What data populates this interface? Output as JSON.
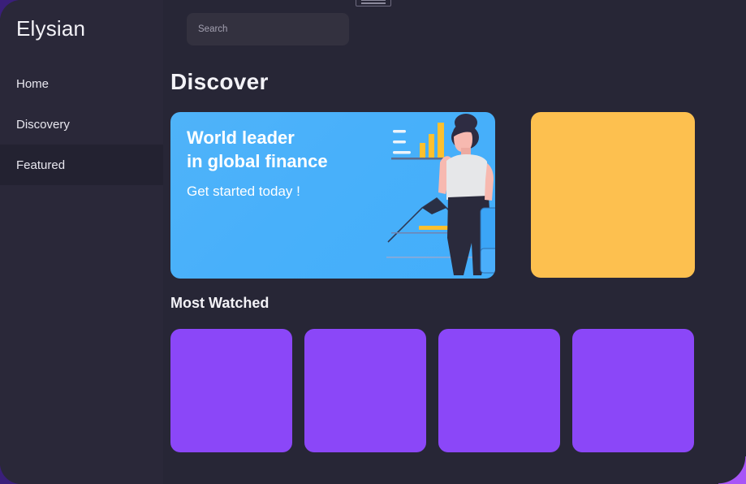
{
  "app": {
    "brand": "Elysian",
    "accent_purple": "#8b47f8",
    "accent_yellow": "#fdc04f",
    "accent_blue": "#48b0fa",
    "background": "#272636",
    "sidebar_background": "#2a2839"
  },
  "window_handle": {
    "icon": "window-drag-handle-icon"
  },
  "search": {
    "placeholder": "Search",
    "value": ""
  },
  "sidebar": {
    "items": [
      {
        "label": "Home",
        "active": false
      },
      {
        "label": "Discovery",
        "active": false
      },
      {
        "label": "Featured",
        "active": true
      }
    ]
  },
  "main": {
    "page_title": "Discover",
    "hero": {
      "title": "World leader\nin global finance",
      "subtitle": "Get started today !",
      "illustration": "business-woman-with-bar-chart-illustration",
      "background_color": "#48b0fa"
    },
    "promo": {
      "background_color": "#fdc04f",
      "label": ""
    },
    "section": {
      "title": "Most Watched",
      "cards": [
        {
          "label": "",
          "background_color": "#8b47f8"
        },
        {
          "label": "",
          "background_color": "#8b47f8"
        },
        {
          "label": "",
          "background_color": "#8b47f8"
        },
        {
          "label": "",
          "background_color": "#8b47f8"
        }
      ]
    }
  }
}
